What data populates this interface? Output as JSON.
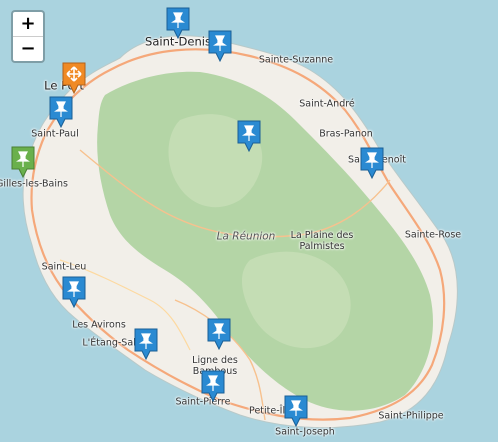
{
  "controls": {
    "zoom_in": "+",
    "zoom_out": "−"
  },
  "island_label": "La Réunion",
  "colors": {
    "sea": "#aad3df",
    "land": "#f2efe9",
    "forest": "#add19e",
    "road": "#f5a87a",
    "marker_blue": "#2a8ad2",
    "marker_green": "#6ab04c",
    "marker_orange": "#f08a24"
  },
  "places": [
    "Saint-Denis",
    "Sainte-Suzanne",
    "Le Port",
    "Saint-André",
    "Saint-Paul",
    "Bras-Panon",
    "Saint-Benoît",
    "Saint-Gilles-les-Bains",
    "La Plaine des Palmistes",
    "Sainte-Rose",
    "Saint-Leu",
    "Les Avirons",
    "L'Étang-Salé",
    "Ligne des Bambous",
    "Saint-Pierre",
    "Petite-Île",
    "Saint-Philippe",
    "Saint-Joseph"
  ],
  "markers": [
    {
      "name": "marker-saint-denis-west",
      "icon": "pushpin-icon",
      "color": "blue"
    },
    {
      "name": "marker-saint-denis-east",
      "icon": "pushpin-icon",
      "color": "blue"
    },
    {
      "name": "marker-le-port",
      "icon": "arrows-icon",
      "color": "orange"
    },
    {
      "name": "marker-saint-paul",
      "icon": "pushpin-icon",
      "color": "blue"
    },
    {
      "name": "marker-saint-gilles",
      "icon": "pushpin-icon",
      "color": "green"
    },
    {
      "name": "marker-salazie",
      "icon": "pushpin-icon",
      "color": "blue"
    },
    {
      "name": "marker-saint-benoit",
      "icon": "pushpin-icon",
      "color": "blue"
    },
    {
      "name": "marker-saint-leu",
      "icon": "pushpin-icon",
      "color": "blue"
    },
    {
      "name": "marker-etang-sale",
      "icon": "pushpin-icon",
      "color": "blue"
    },
    {
      "name": "marker-ligne-des-bambous",
      "icon": "pushpin-icon",
      "color": "blue"
    },
    {
      "name": "marker-saint-pierre",
      "icon": "pushpin-icon",
      "color": "blue"
    },
    {
      "name": "marker-petite-ile",
      "icon": "pushpin-icon",
      "color": "blue"
    }
  ]
}
